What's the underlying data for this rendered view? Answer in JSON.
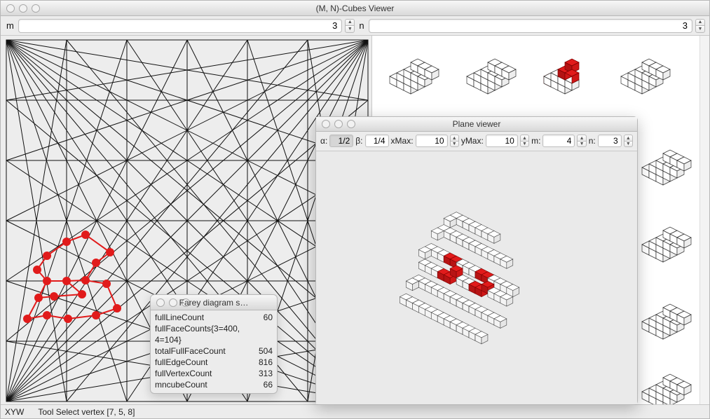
{
  "main": {
    "title": "(M, N)-Cubes Viewer",
    "m_label": "m",
    "m_value": "3",
    "n_label": "n",
    "n_value": "3"
  },
  "status": {
    "mode": "XYW",
    "tool": "Tool Select vertex [7, 5, 8]"
  },
  "farey_popup": {
    "title": "Farey diagram s…",
    "rows": [
      {
        "k": "fullLineCount",
        "v": "60"
      },
      {
        "k": "fullFaceCounts{3=400, 4=104}",
        "v": ""
      },
      {
        "k": "totalFullFaceCount",
        "v": "504"
      },
      {
        "k": "fullEdgeCount",
        "v": "816"
      },
      {
        "k": "fullVertexCount",
        "v": "313"
      },
      {
        "k": "mncubeCount",
        "v": "66"
      }
    ]
  },
  "plane": {
    "title": "Plane viewer",
    "alpha_label": "α:",
    "alpha": "1/2",
    "beta_label": "β:",
    "beta": "1/4",
    "xmax_label": "xMax:",
    "xmax": "10",
    "ymax_label": "yMax:",
    "ymax": "10",
    "m_label": "m:",
    "m": "4",
    "n_label": "n:",
    "n": "3"
  },
  "colors": {
    "highlight": "#e11b1b",
    "line": "#111111"
  }
}
